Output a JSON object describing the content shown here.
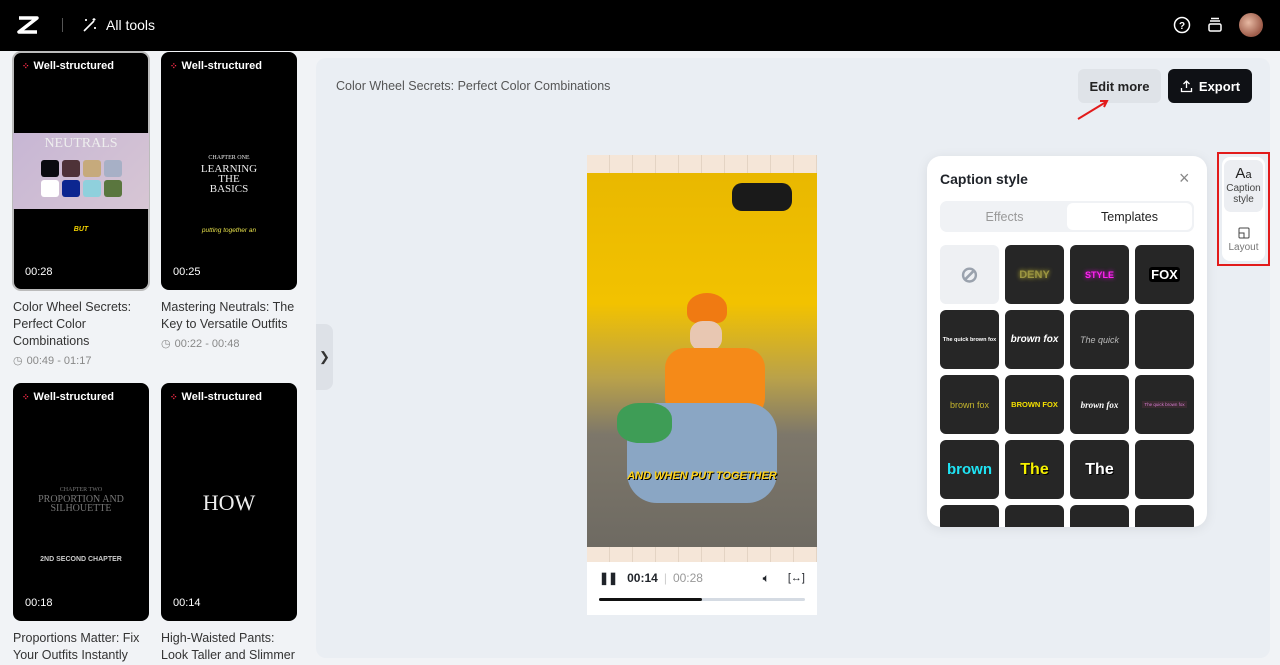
{
  "header": {
    "app_logo": "capcut-logo",
    "all_tools_label": "All tools",
    "icons": [
      "help-icon",
      "layers-icon",
      "avatar"
    ]
  },
  "sidebar": {
    "cards": [
      {
        "badge": "Well-structured",
        "duration": "00:28",
        "title": "Color Wheel Secrets: Perfect Color Combinations",
        "range": "00:49 - 01:17",
        "thumb_text": "NEUTRALS",
        "caption": "BUT",
        "selected": true
      },
      {
        "badge": "Well-structured",
        "duration": "00:25",
        "title": "Mastering Neutrals: The Key to Versatile Outfits",
        "range": "00:22 - 00:48",
        "thumb_kicker": "CHAPTER ONE",
        "thumb_text": "LEARNING THE BASICS",
        "caption": "putting together an"
      },
      {
        "badge": "Well-structured",
        "duration": "00:18",
        "title": "Proportions Matter: Fix Your Outfits Instantly",
        "thumb_kicker": "CHAPTER TWO",
        "thumb_text": "PROPORTION AND SILHOUETTE",
        "caption": "2ND SECOND CHAPTER"
      },
      {
        "badge": "Well-structured",
        "duration": "00:14",
        "title": "High-Waisted Pants: Look Taller and Slimmer",
        "thumb_text": "HOW"
      }
    ]
  },
  "main": {
    "title": "Color Wheel Secrets: Perfect Color Combinations",
    "edit_more": "Edit more",
    "export": "Export"
  },
  "player": {
    "subtitle": "AND WHEN PUT TOGETHER",
    "current": "00:14",
    "total": "00:28",
    "progress_percent": 50
  },
  "caption_panel": {
    "title": "Caption style",
    "tabs": [
      "Effects",
      "Templates"
    ],
    "active_tab": "Templates",
    "templates": [
      "",
      "DENY",
      "STYLE",
      "FOX",
      "The quick brown fox",
      "brown fox",
      "The quick",
      "",
      "brown fox",
      "BROWN FOX",
      "brown fox",
      "The quick brown fox",
      "brown",
      "The",
      "The",
      "",
      "",
      "",
      "",
      ""
    ]
  },
  "rail": {
    "caption_style": "Caption style",
    "layout": "Layout"
  },
  "colors": {
    "accent_red": "#e21b1b",
    "dark_button": "#0f1115"
  }
}
